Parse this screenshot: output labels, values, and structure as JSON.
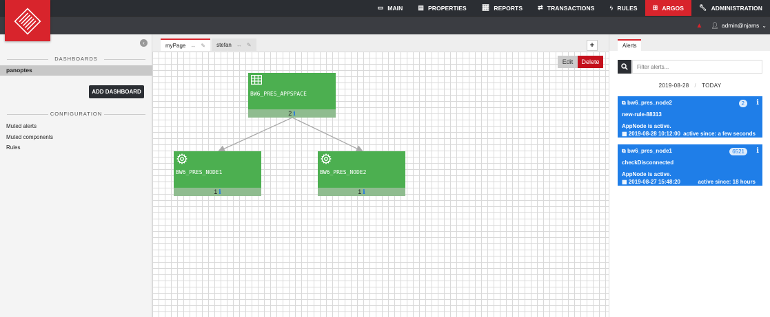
{
  "nav": {
    "items": [
      {
        "label": "MAIN",
        "icon": "monitor-icon"
      },
      {
        "label": "PROPERTIES",
        "icon": "list-icon"
      },
      {
        "label": "REPORTS",
        "icon": "chart-icon"
      },
      {
        "label": "TRANSACTIONS",
        "icon": "exchange-icon"
      },
      {
        "label": "RULES",
        "icon": "bolt-icon"
      },
      {
        "label": "ARGOS",
        "icon": "grid-icon",
        "active": true
      },
      {
        "label": "ADMINISTRATION",
        "icon": "wrench-icon"
      }
    ],
    "user": "admin@njams"
  },
  "sidebar": {
    "dashboards_title": "DASHBOARDS",
    "dashboard_item": "panoptes",
    "add_dashboard": "ADD DASHBOARD",
    "config_title": "CONFIGURATION",
    "config_items": [
      "Muted alerts",
      "Muted components",
      "Rules"
    ]
  },
  "workspace": {
    "tabs": [
      {
        "label": "myPage",
        "active": true
      },
      {
        "label": "stefan",
        "active": false
      }
    ],
    "add_tab": "+",
    "edit": "Edit",
    "delete": "Delete",
    "nodes": [
      {
        "label": "BW6_PRES_APPSPACE",
        "count": "2",
        "icon": "table-icon"
      },
      {
        "label": "BW6_PRES_NODE1",
        "count": "1",
        "icon": "gear-icon"
      },
      {
        "label": "BW6_PRES_NODE2",
        "count": "1",
        "icon": "gear-icon"
      }
    ],
    "info_glyph": "i"
  },
  "alerts": {
    "tab": "Alerts",
    "search_placeholder": "Filter alerts...",
    "date": "2019-08-28",
    "today": "TODAY",
    "cards": [
      {
        "node": "bw6_pres_node2",
        "count": "2",
        "rule": "new-rule-88313",
        "message": "AppNode is active.",
        "time": "2019-08-28 10:12:00",
        "since": "active since: a few seconds"
      },
      {
        "node": "bw6_pres_node1",
        "count": "6521",
        "rule": "checkDisconnected",
        "message": "AppNode is active.",
        "time": "2019-08-27 15:48:20",
        "since": "active since: 18 hours"
      }
    ]
  },
  "colors": {
    "brand": "#d8242c",
    "node": "#4caf50",
    "alert": "#1f7ee8",
    "dark": "#2b2e33"
  }
}
